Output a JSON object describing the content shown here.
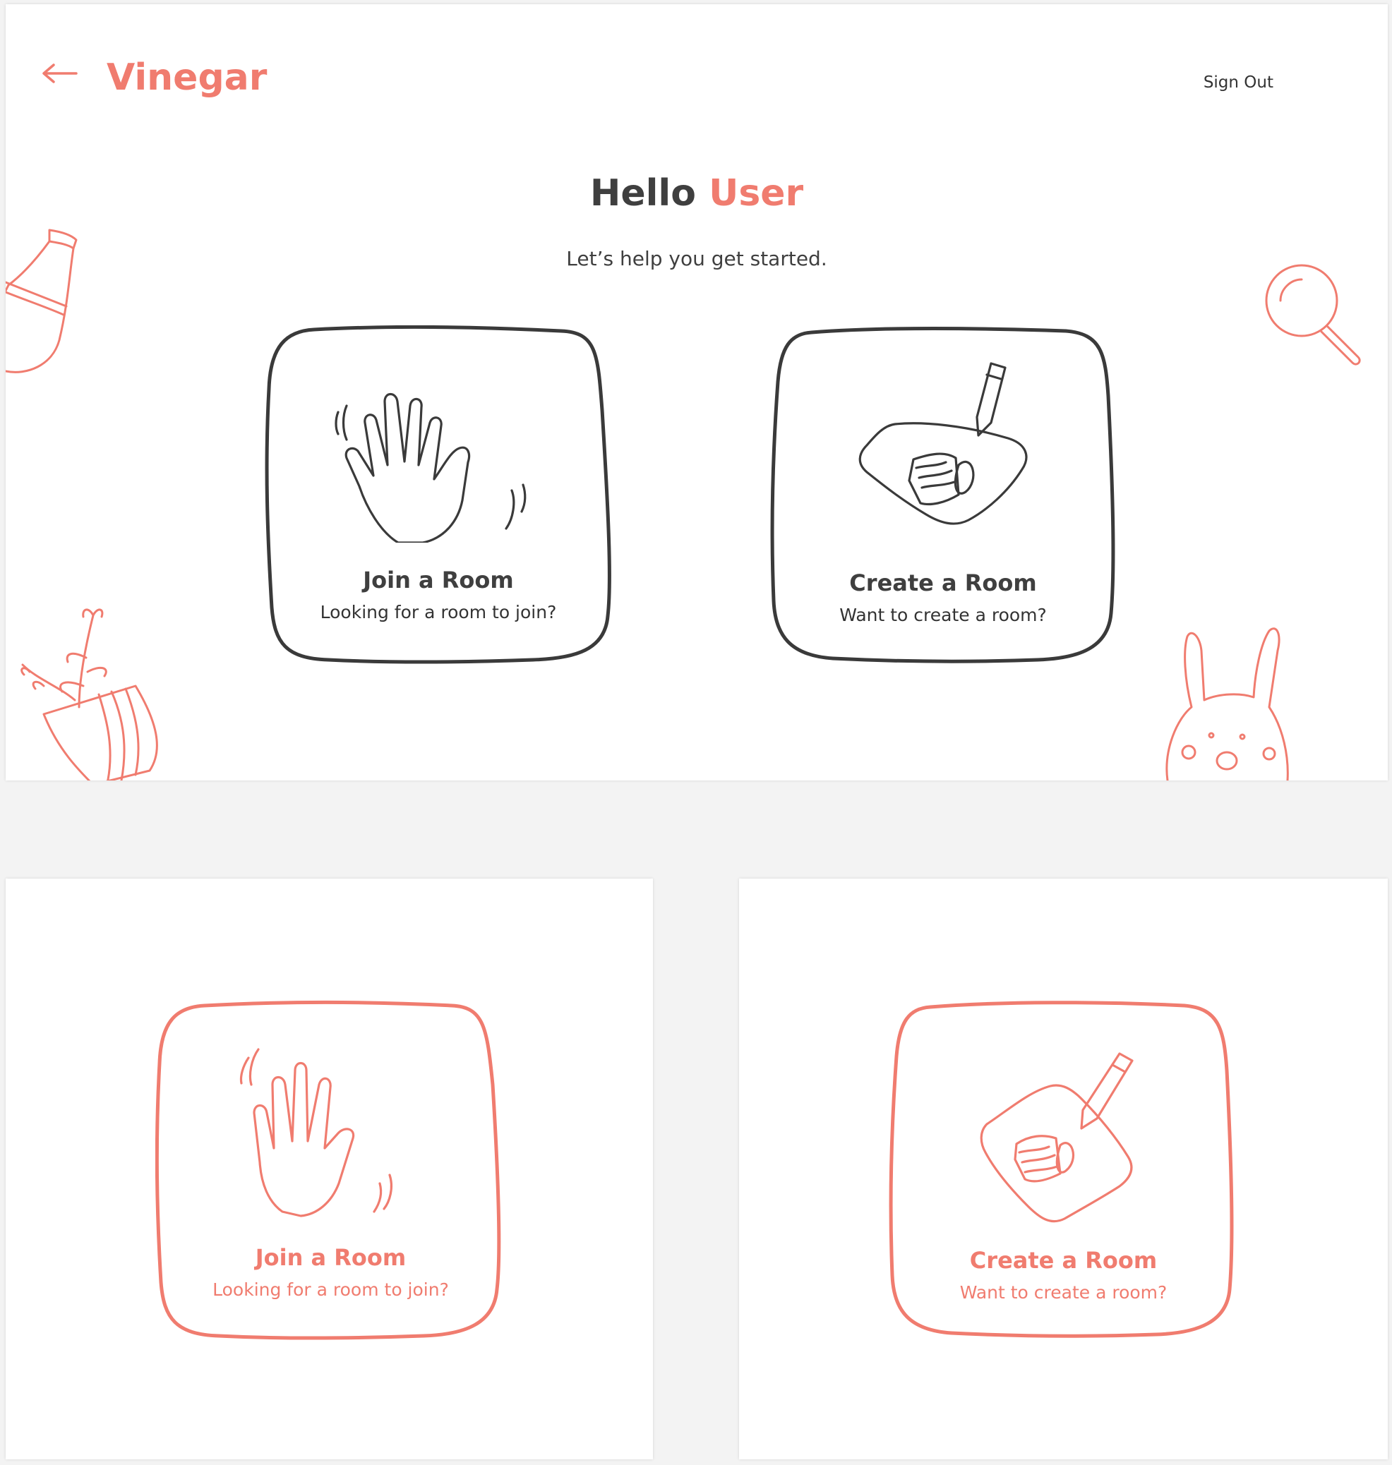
{
  "colors": {
    "accent": "#f07c6f",
    "text": "#3f3f3f",
    "card_border": "#3a3a3a"
  },
  "header": {
    "back_icon": "back-arrow-icon",
    "brand": "Vinegar",
    "sign_out": "Sign Out"
  },
  "greeting": {
    "prefix": "Hello",
    "user": "User",
    "subtitle": "Let’s help you get started."
  },
  "cards": {
    "join": {
      "title": "Join a Room",
      "subtitle": "Looking for a room to join?",
      "icon": "waving-hand-icon"
    },
    "create": {
      "title": "Create a Room",
      "subtitle": "Want to create a room?",
      "icon": "pencil-drawing-icon"
    }
  },
  "hover_states": {
    "join": {
      "title": "Join a Room",
      "subtitle": "Looking for a room to join?"
    },
    "create": {
      "title": "Create a Room",
      "subtitle": "Want to create a room?"
    }
  },
  "decorations": [
    "vase-doodle",
    "magnifier-doodle",
    "plant-doodle",
    "bunny-doodle"
  ]
}
